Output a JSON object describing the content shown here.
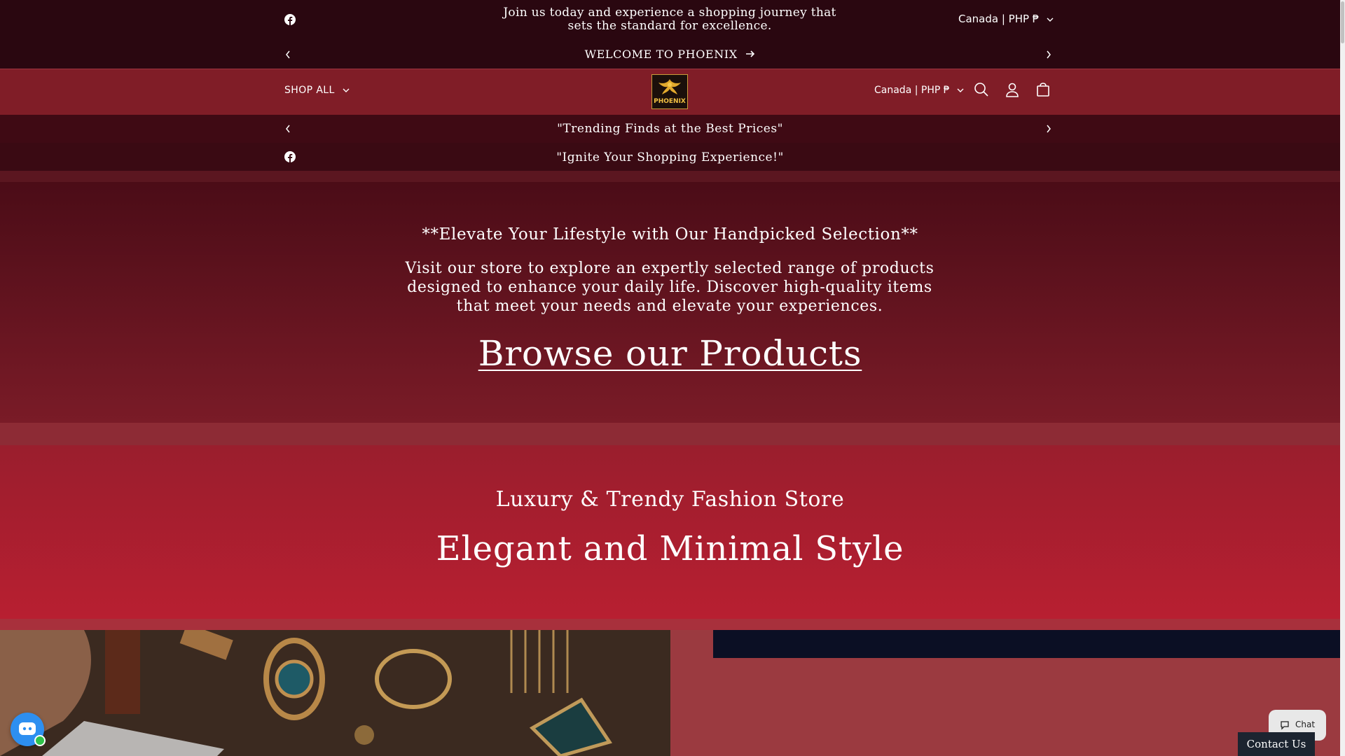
{
  "top_bar": {
    "promo": "Join us today and experience a shopping journey that sets the standard for excellence.",
    "region": "Canada | PHP ₱",
    "welcome": "WELCOME TO PHOENIX"
  },
  "header": {
    "shop_all": "SHOP ALL",
    "logo_text": "PHOENIX",
    "region": "Canada | PHP ₱"
  },
  "announcements": {
    "first": "\"Trending Finds at the Best Prices\"",
    "second": "\"Ignite Your Shopping Experience!\""
  },
  "hero": {
    "heading": "**Elevate Your Lifestyle with Our Handpicked Selection**",
    "paragraph": "Visit our store to explore an expertly selected range of products designed to enhance your daily life. Discover high-quality items that meet your needs and elevate your experiences.",
    "link": "Browse our Products"
  },
  "section2": {
    "subtitle": "Luxury & Trendy Fashion Store",
    "title": "Elegant and Minimal Style"
  },
  "widgets": {
    "chat": "Chat",
    "contact": "Contact Us"
  },
  "colors": {
    "top_bar": "#2a0710",
    "header": "#801d27",
    "hero_gradient_start": "#4b0c17",
    "section_red": "#b81f31",
    "chat_blue": "#2d8ff0"
  }
}
